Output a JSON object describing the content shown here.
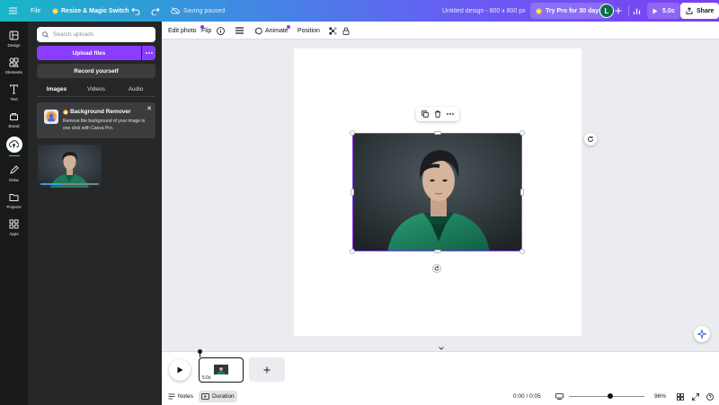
{
  "topbar": {
    "file_label": "File",
    "resize_label": "Resize & Magic Switch",
    "status_label": "Saving paused",
    "doc_title": "Untitled design - 800 x 800 px",
    "pro_label": "Try Pro for 30 days",
    "avatar_initial": "L",
    "play_duration": "5.0s",
    "share_label": "Share"
  },
  "rail": {
    "items": [
      {
        "label": "Design",
        "icon": "design-icon"
      },
      {
        "label": "Elements",
        "icon": "elements-icon"
      },
      {
        "label": "Text",
        "icon": "text-icon"
      },
      {
        "label": "Brand",
        "icon": "brand-icon"
      },
      {
        "label": "",
        "icon": "uploads-icon"
      },
      {
        "label": "Draw",
        "icon": "draw-icon"
      },
      {
        "label": "Projects",
        "icon": "projects-icon"
      },
      {
        "label": "Apps",
        "icon": "apps-icon"
      }
    ]
  },
  "panel": {
    "search_placeholder": "Search uploads",
    "upload_label": "Upload files",
    "record_label": "Record yourself",
    "tabs": [
      "Images",
      "Videos",
      "Audio"
    ],
    "active_tab": "Images",
    "promo": {
      "title": "Background Remover",
      "desc": "Remove the background of your image in one click with Canva Pro."
    }
  },
  "context_toolbar": {
    "edit_photo": "Edit photo",
    "flip": "Flip",
    "animate": "Animate",
    "position": "Position"
  },
  "timeline": {
    "clip_duration": "5.0s"
  },
  "bottombar": {
    "notes": "Notes",
    "duration": "Duration",
    "time": "0:00 / 0:05",
    "zoom": "96%",
    "zoom_level_fraction": 0.55
  },
  "colors": {
    "accent": "#8b3dff",
    "rail_bg": "#18191b",
    "panel_bg": "#252627",
    "workspace_bg": "#ebecf0"
  }
}
